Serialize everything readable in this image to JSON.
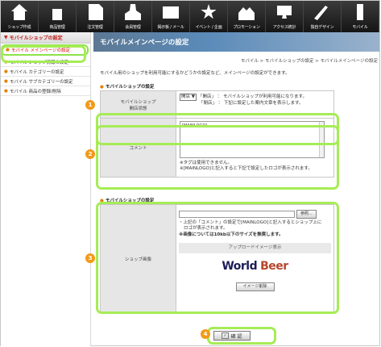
{
  "topnav": [
    {
      "label": "ショップ作成",
      "icon": "house-icon"
    },
    {
      "label": "商品管理",
      "icon": "box-icon"
    },
    {
      "label": "注文管理",
      "icon": "doc-icon"
    },
    {
      "label": "会員管理",
      "icon": "user-icon"
    },
    {
      "label": "掲示板 / メール",
      "icon": "board-icon"
    },
    {
      "label": "イベント / 企画",
      "icon": "star-icon"
    },
    {
      "label": "プロモーション",
      "icon": "people-icon"
    },
    {
      "label": "アクセス統計",
      "icon": "pc-icon"
    },
    {
      "label": "独自デザイン",
      "icon": "brush-icon"
    },
    {
      "label": "モバイル",
      "icon": "phone-icon"
    }
  ],
  "sidebar": {
    "title": "モバイルショップの設定",
    "items": [
      {
        "label": "モバイル メインページの設定"
      },
      {
        "label": "モバイル ショップ情報の設定"
      },
      {
        "label": "モバイル カテゴリーの設定"
      },
      {
        "label": "モバイル サブカテゴリーの設定"
      },
      {
        "label": "モバイル 商品の登録/削除"
      }
    ]
  },
  "main": {
    "banner": "モバイルメインページの設定",
    "breadcrumb": "モバイル > モバイルショップの設定 > モバイルメインページの設定",
    "intro": "モバイル用のショップを利用可能にするかどうかの設定など、メインページの設定ができます。",
    "section1": "モバイルショップの設定",
    "section2": "モバイルショップの設定",
    "status": {
      "label": "モバイルショップ\n開店状態",
      "select": "開店",
      "line1": "「開店」 ： モバイルショップが利用可能になります。",
      "line2": "「閉店」 ： 下記に設定した案内文章を表示します。"
    },
    "comment": {
      "label": "コメント",
      "value": "[MAINLOGO]",
      "note1": "※タグは使用できません。",
      "note2": "※[MAINLOGO]と記入すると下記で設定したロゴが表示されます。"
    },
    "image": {
      "label": "ショップ画像",
      "browse": "参照...",
      "note1": "・上記の「コメント」の設定で[MAINLOGO]と記入するとショップ上に",
      "note2": "ロゴが表示されます。",
      "note3": "※画像については10kb以下のサイズを推奨します。",
      "preview_header": "アップロードイメージ表示",
      "logo_a": "World",
      "logo_b": "Beer",
      "delete": "イメージ削除"
    },
    "submit": "確 認"
  },
  "callouts": [
    "1",
    "2",
    "3",
    "4"
  ],
  "colors": {
    "highlight": "#a6ec56",
    "callout": "#f29a18",
    "banner": "#5b8bb9"
  }
}
